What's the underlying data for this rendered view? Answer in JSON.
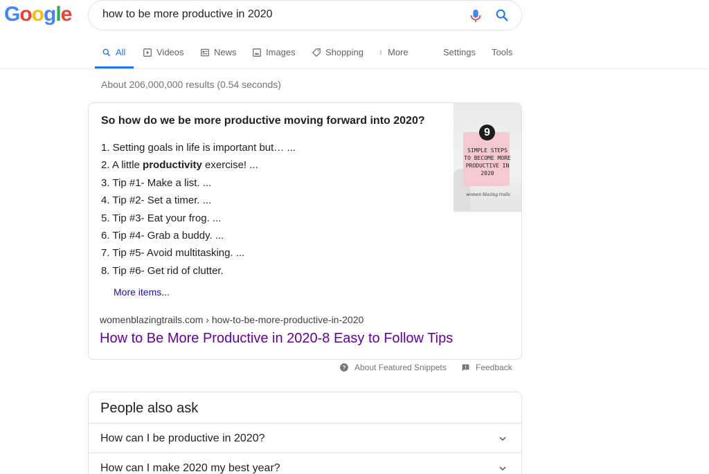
{
  "logo": {
    "letters": [
      "G",
      "o",
      "o",
      "g",
      "l",
      "e"
    ]
  },
  "search": {
    "query": "how to be more productive in 2020"
  },
  "tabs": [
    {
      "label": "All",
      "icon": "search-icon"
    },
    {
      "label": "Videos",
      "icon": "video-icon"
    },
    {
      "label": "News",
      "icon": "news-icon"
    },
    {
      "label": "Images",
      "icon": "image-icon"
    },
    {
      "label": "Shopping",
      "icon": "tag-icon"
    },
    {
      "label": "More",
      "icon": "more-vert-icon"
    },
    {
      "label": "Settings"
    },
    {
      "label": "Tools"
    }
  ],
  "stats": "About 206,000,000 results (0.54 seconds)",
  "snippet": {
    "heading": "So how do we be more productive moving forward into 2020?",
    "items": [
      "1. Setting goals in life is important but… ...",
      "2. A little ",
      "3. Tip #1- Make a list. ...",
      "4. Tip #2- Set a timer. ...",
      "5. Tip #3- Eat your frog. ...",
      "6. Tip #4- Grab a buddy. ...",
      "7. Tip #5- Avoid multitasking. ...",
      "8. Tip #6- Get rid of clutter."
    ],
    "item2_bold": "productivity",
    "item2_rest": " exercise! ...",
    "more_items": "More items...",
    "cite": "womenblazingtrails.com › how-to-be-more-productive-in-2020",
    "title": "How to Be More Productive in 2020-8 Easy to Follow Tips",
    "thumbnail": {
      "number": "9",
      "text": "SIMPLE STEPS TO BECOME MORE PRODUCTIVE IN 2020",
      "brand": "women blazing trails"
    }
  },
  "footer": {
    "about": "About Featured Snippets",
    "feedback": "Feedback"
  },
  "paa": {
    "title": "People also ask",
    "questions": [
      "How can I be productive in 2020?",
      "How can I make 2020 my best year?"
    ]
  },
  "colors": {
    "accent": "#1a73e8",
    "visited_link": "#660099",
    "link": "#1a0dab",
    "mic_red": "#ea4335"
  }
}
